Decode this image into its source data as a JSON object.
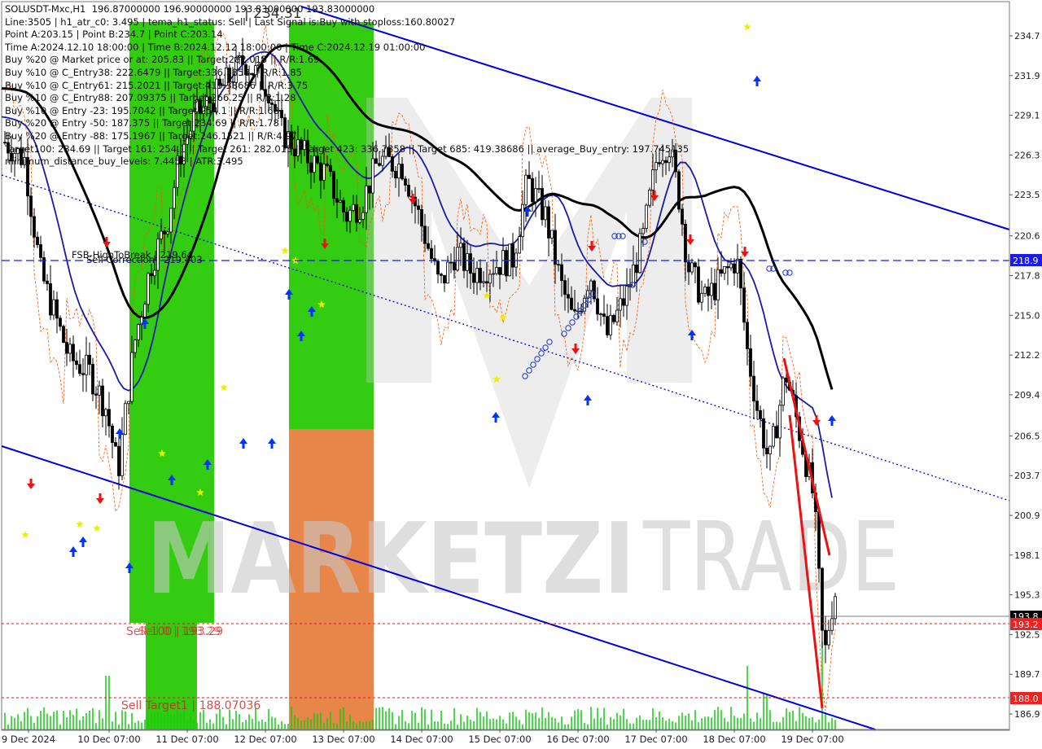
{
  "header": {
    "lines": [
      "SOLUSDT-Mxc,H1  196.87000000 196.90000000 193.83000000 193.83000000",
      "Line:3505 | h1_atr_c0: 3.495 | tema_h1_status: Sell | Last Signal is:Buy with stoploss:160.80027",
      "Point A:203.15 | Point B:234.7 | Point C:203.14",
      "Time A:2024.12.10 18:00:00 | Time B:2024.12.12 18:00:00 | Time C:2024.12.19 01:00:00",
      "Buy %20 @ Market price or at: 205.83 || Target:282.015 || R/R:1.69",
      "Buy %10 @ C_Entry38: 222.6479 || Target:336.7858 || R/R:1.85",
      "Buy %10 @ C_Entry61: 215.2021 || Target:419.38686 || R/R:3.75",
      "Buy %10 @ C_Entry88: 207.09375 || Target:266.25 || R/R:1.28",
      "Buy %10 @ Entry -23: 195.7042 || Target:254.1 || R/R:1.68",
      "Buy %20 @ Entry -50: 187.375 || Target:234.69 || R/R:1.78",
      "Buy %20 @ Entry -88: 175.1967 || Target:246.1521 || R/R:4.97",
      "Target100: 234.69 || Target 161: 254.1 || Target 261: 282.015 || Target 423: 336.7858 || Target 685: 419.38686 || average_Buy_entry: 197.745135",
      "minimum_distance_buy_levels: 7.4458 | ATR:3.495"
    ],
    "overlay_value": "| 234.31"
  },
  "watermark": {
    "text_left": "MARKETZI",
    "text_right": "TRADE"
  },
  "annotations": {
    "fsb_line_label": "FSB-HighToBreak | 219.64",
    "sell_correction_label": "Sell Correction | 219.403",
    "sell_stop_label": "Sell 100 | 193.29",
    "sell_stop_ghost": "Sell 0 | 193.29",
    "sell_target_label": "Sell Target1 | 188.07036"
  },
  "price_tags": {
    "fsb": "218.9",
    "current": "193.8",
    "sell_stop": "193.2",
    "sell_target": "188.0"
  },
  "colors": {
    "candle": "#000000",
    "channel": "#0000dd",
    "ma_black": "#000000",
    "ma_blue": "#1a1aa8",
    "envelope": "#ff5500",
    "zone_green": "#33cc11",
    "zone_orange": "#e8864a",
    "buy_arrow": "#0033ff",
    "sell_arrow": "#ee1111",
    "volume": "#11cc11",
    "star": "#eeee00"
  },
  "chart_data": {
    "type": "candlestick",
    "symbol": "SOLUSDT-Mxc",
    "timeframe": "H1",
    "ohlc_last": {
      "open": 196.87,
      "high": 196.9,
      "low": 193.83,
      "close": 193.83
    },
    "y_axis": {
      "range": [
        186.0,
        236.0
      ],
      "ticks": [
        234.7,
        231.9,
        229.1,
        226.3,
        223.5,
        220.6,
        217.8,
        215.0,
        212.2,
        209.4,
        206.5,
        203.7,
        200.9,
        198.1,
        195.3,
        192.5,
        189.7,
        186.9
      ]
    },
    "x_axis": {
      "ticks": [
        "9 Dec 2024",
        "10 Dec 07:00",
        "11 Dec 07:00",
        "12 Dec 07:00",
        "13 Dec 07:00",
        "14 Dec 07:00",
        "15 Dec 07:00",
        "16 Dec 07:00",
        "17 Dec 07:00",
        "18 Dec 07:00",
        "19 Dec 07:00"
      ]
    },
    "levels": {
      "fsb_high_to_break": 219.64,
      "sell_correction": 219.403,
      "sell_stop": 193.29,
      "sell_target1": 188.07036
    },
    "close_path_keypoints": [
      [
        0,
        227.5
      ],
      [
        30,
        226.0
      ],
      [
        50,
        218.0
      ],
      [
        85,
        212.0
      ],
      [
        110,
        211.0
      ],
      [
        130,
        208.5
      ],
      [
        145,
        204.0
      ],
      [
        165,
        213.0
      ],
      [
        185,
        218.5
      ],
      [
        205,
        221.5
      ],
      [
        222,
        226.5
      ],
      [
        240,
        229.0
      ],
      [
        265,
        230.5
      ],
      [
        300,
        233.0
      ],
      [
        330,
        231.0
      ],
      [
        345,
        228.0
      ],
      [
        370,
        226.5
      ],
      [
        400,
        225.0
      ],
      [
        425,
        222.0
      ],
      [
        445,
        223.0
      ],
      [
        465,
        226.0
      ],
      [
        495,
        225.5
      ],
      [
        520,
        221.0
      ],
      [
        540,
        217.0
      ],
      [
        560,
        219.5
      ],
      [
        580,
        218.0
      ],
      [
        605,
        218.5
      ],
      [
        630,
        219.0
      ],
      [
        648,
        224.5
      ],
      [
        670,
        222.0
      ],
      [
        690,
        217.0
      ],
      [
        705,
        214.5
      ],
      [
        725,
        218.0
      ],
      [
        745,
        213.5
      ],
      [
        770,
        216.5
      ],
      [
        790,
        220.5
      ],
      [
        808,
        226.5
      ],
      [
        822,
        227.0
      ],
      [
        835,
        223.0
      ],
      [
        845,
        218.5
      ],
      [
        865,
        216.0
      ],
      [
        885,
        217.5
      ],
      [
        905,
        219.0
      ],
      [
        918,
        212.5
      ],
      [
        930,
        208.5
      ],
      [
        945,
        204.5
      ],
      [
        965,
        211.0
      ],
      [
        985,
        206.0
      ],
      [
        1000,
        202.0
      ],
      [
        1012,
        190.5
      ],
      [
        1020,
        194.0
      ],
      [
        1026,
        195.5
      ]
    ],
    "volume_spikes": [
      [
        132,
        0.55
      ],
      [
        918,
        0.65
      ],
      [
        940,
        0.37
      ],
      [
        1010,
        0.9
      ]
    ]
  }
}
